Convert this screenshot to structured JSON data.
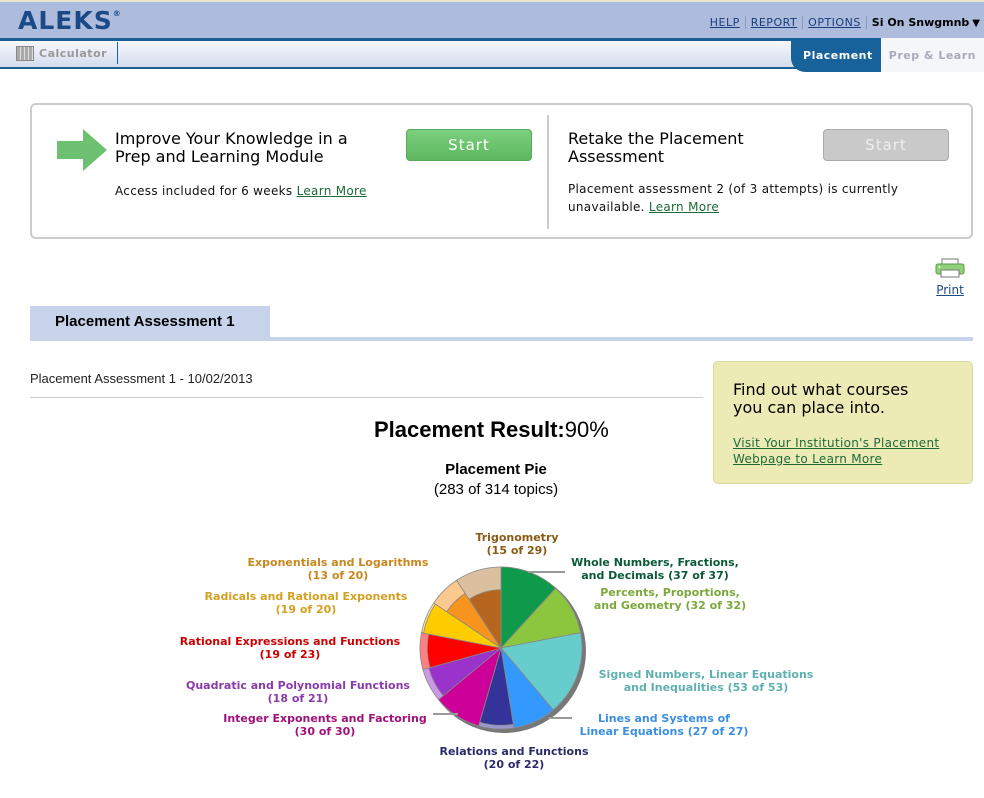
{
  "header": {
    "logo": "ALEKS",
    "logo_mark": "®",
    "links": [
      "HELP",
      "REPORT",
      "OPTIONS"
    ],
    "user": "Si On Snwgmnb",
    "user_caret": "▼"
  },
  "navbar": {
    "calculator": "Calculator",
    "tabs": [
      {
        "label": "Placement",
        "active": true
      },
      {
        "label": "Prep & Learn",
        "active": false
      }
    ]
  },
  "cards": {
    "prep": {
      "title_line1": "Improve Your Knowledge in a",
      "title_line2": "Prep and Learning Module",
      "button": "Start",
      "text": "Access included for 6 weeks",
      "link": "Learn More"
    },
    "retake": {
      "title_line1": "Retake the Placement",
      "title_line2": "Assessment",
      "button": "Start",
      "text_line1": "Placement assessment 2 (of 3 attempts) is currently",
      "text_line2": "unavailable.",
      "link": "Learn More"
    }
  },
  "print": {
    "label": "Print"
  },
  "assessment": {
    "tab": "Placement Assessment 1",
    "date_line": "Placement Assessment 1 - 10/02/2013",
    "result_label": "Placement Result:",
    "result_value": "90%"
  },
  "promo": {
    "title_line1": "Find out what courses",
    "title_line2": "you can place into.",
    "link_line1": "Visit Your Institution's Placement",
    "link_line2": "Webpage to Learn More"
  },
  "chart_data": {
    "type": "pie",
    "title": "Placement Pie",
    "subtitle": "(283 of 314 topics)",
    "total_mastered": 283,
    "total_topics": 314,
    "slices": [
      {
        "name": "Whole Numbers, Fractions, and Decimals",
        "label1": "Whole Numbers, Fractions,",
        "label2": "and Decimals (37 of 37)",
        "mastered": 37,
        "total": 37,
        "color": "#0e9a4a",
        "light": "#7fd0a0",
        "text": "#0b5a37"
      },
      {
        "name": "Percents, Proportions, and Geometry",
        "label1": "Percents, Proportions,",
        "label2": "and Geometry (32 of 32)",
        "mastered": 32,
        "total": 32,
        "color": "#8cc63f",
        "light": "#c6e29f",
        "text": "#7aa83a"
      },
      {
        "name": "Signed Numbers, Linear Equations and Inequalities",
        "label1": "Signed Numbers, Linear Equations",
        "label2": "and Inequalities (53 of 53)",
        "mastered": 53,
        "total": 53,
        "color": "#66cccc",
        "light": "#b3e6e6",
        "text": "#5fb0b0"
      },
      {
        "name": "Lines and Systems of Linear Equations",
        "label1": "Lines and Systems of",
        "label2": "Linear Equations (27 of 27)",
        "mastered": 27,
        "total": 27,
        "color": "#3399ff",
        "light": "#99ccff",
        "text": "#3b8ee0"
      },
      {
        "name": "Relations and Functions",
        "label1": "Relations and Functions",
        "label2": "(20 of 22)",
        "mastered": 20,
        "total": 22,
        "color": "#333399",
        "light": "#9999cc",
        "text": "#2b2b6b"
      },
      {
        "name": "Integer Exponents and Factoring",
        "label1": "Integer Exponents and Factoring",
        "label2": "(30 of 30)",
        "mastered": 30,
        "total": 30,
        "color": "#cc0099",
        "light": "#e680cc",
        "text": "#a0107a"
      },
      {
        "name": "Quadratic and Polynomial Functions",
        "label1": "Quadratic and Polynomial Functions",
        "label2": "(18 of 21)",
        "mastered": 18,
        "total": 21,
        "color": "#9933cc",
        "light": "#cc99e6",
        "text": "#8a3aaa"
      },
      {
        "name": "Rational Expressions and Functions",
        "label1": "Rational Expressions and Functions",
        "label2": "(19 of 23)",
        "mastered": 19,
        "total": 23,
        "color": "#ff0000",
        "light": "#ff8080",
        "text": "#cc0000"
      },
      {
        "name": "Radicals and Rational Exponents",
        "label1": "Radicals and Rational Exponents",
        "label2": "(19 of 20)",
        "mastered": 19,
        "total": 20,
        "color": "#ffcc00",
        "light": "#ffe680",
        "text": "#d4a020"
      },
      {
        "name": "Exponentials and Logarithms",
        "label1": "Exponentials and Logarithms",
        "label2": "(13 of 20)",
        "mastered": 13,
        "total": 20,
        "color": "#f7941d",
        "light": "#fbc98e",
        "text": "#c8861f"
      },
      {
        "name": "Trigonometry",
        "label1": "Trigonometry",
        "label2": "(15 of 29)",
        "mastered": 15,
        "total": 29,
        "color": "#b5651d",
        "light": "#dbc0a0",
        "text": "#8a5a14"
      }
    ]
  }
}
